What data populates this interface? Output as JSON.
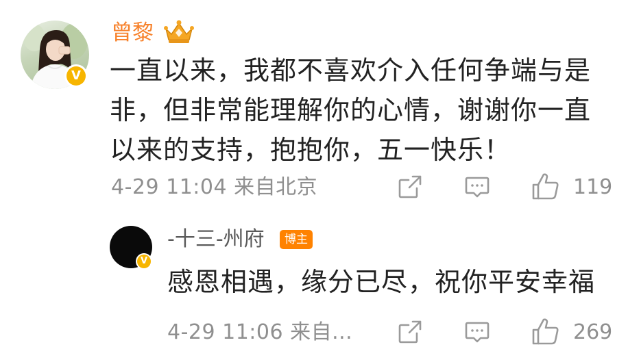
{
  "comment": {
    "username": "曾黎",
    "text": "一直以来，我都不喜欢介入任何争端与是非，但非常能理解你的心情，谢谢你一直以来的支持，抱抱你，五一快乐！",
    "meta": "4-29 11:04 来自北京",
    "like_count": "119",
    "verified_badge": "V",
    "username_color": "#f7822c",
    "badge_color": "#f7b500"
  },
  "reply": {
    "username": "-十三-州府",
    "author_badge": "博主",
    "text": "感恩相遇，缘分已尽，祝你平安幸福",
    "meta": "4-29 11:06 来自...",
    "like_count": "269",
    "verified_badge": "V",
    "author_badge_color": "#ff8200"
  },
  "icons": {
    "share": "share-icon",
    "comment": "comment-icon",
    "like": "like-icon",
    "crown": "crown-badge-icon",
    "verified": "verified-badge-icon"
  }
}
